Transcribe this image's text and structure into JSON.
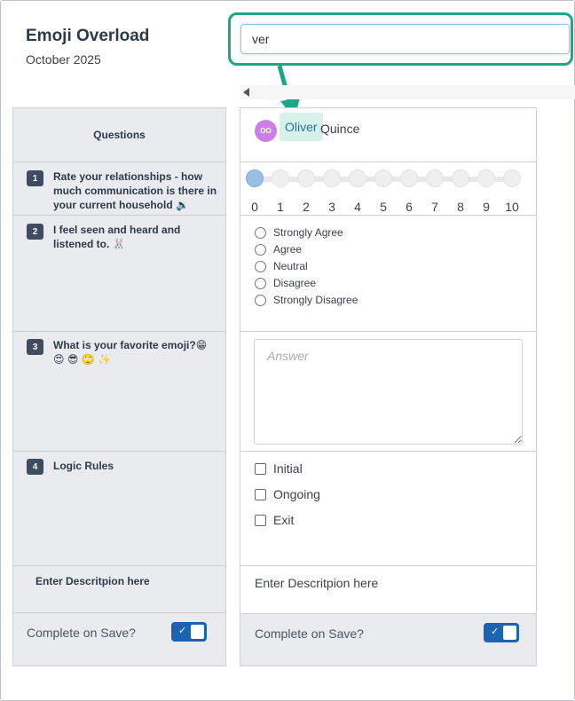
{
  "header": {
    "title": "Emoji Overload",
    "subtitle": "October 2025"
  },
  "search": {
    "value": "ver"
  },
  "colors": {
    "accent_teal": "#1aa886",
    "toggle_blue": "#1d63b3",
    "avatar_purple": "#cf7de8",
    "highlight": "#d6f0ea"
  },
  "questions": {
    "header": "Questions",
    "items": [
      {
        "number": "1",
        "text": "Rate your relationships - how much communication is there in your current household 🔉"
      },
      {
        "number": "2",
        "text": "I feel seen and heard and listened to. 🐰"
      },
      {
        "number": "3",
        "text": "What is your favorite emoji?😁 😍 😎 🙄 ✨"
      },
      {
        "number": "4",
        "text": "Logic Rules"
      }
    ],
    "description": "Enter Descritpion here",
    "complete_label": "Complete on Save?"
  },
  "respondent": {
    "initials": "OO",
    "first_name": "Oliver",
    "last_name": "Quince"
  },
  "scale": {
    "labels": [
      "0",
      "1",
      "2",
      "3",
      "4",
      "5",
      "6",
      "7",
      "8",
      "9",
      "10"
    ],
    "selected": "0"
  },
  "likert": {
    "options": [
      "Strongly Agree",
      "Agree",
      "Neutral",
      "Disagree",
      "Strongly Disagree"
    ]
  },
  "answer": {
    "placeholder": "Answer"
  },
  "logic": {
    "options": [
      "Initial",
      "Ongoing",
      "Exit"
    ]
  },
  "answer_description": "Enter Descritpion here",
  "answer_complete_label": "Complete on Save?",
  "icons": {
    "toggle_check": "✓",
    "scroll_left": "triangle-left-icon"
  }
}
